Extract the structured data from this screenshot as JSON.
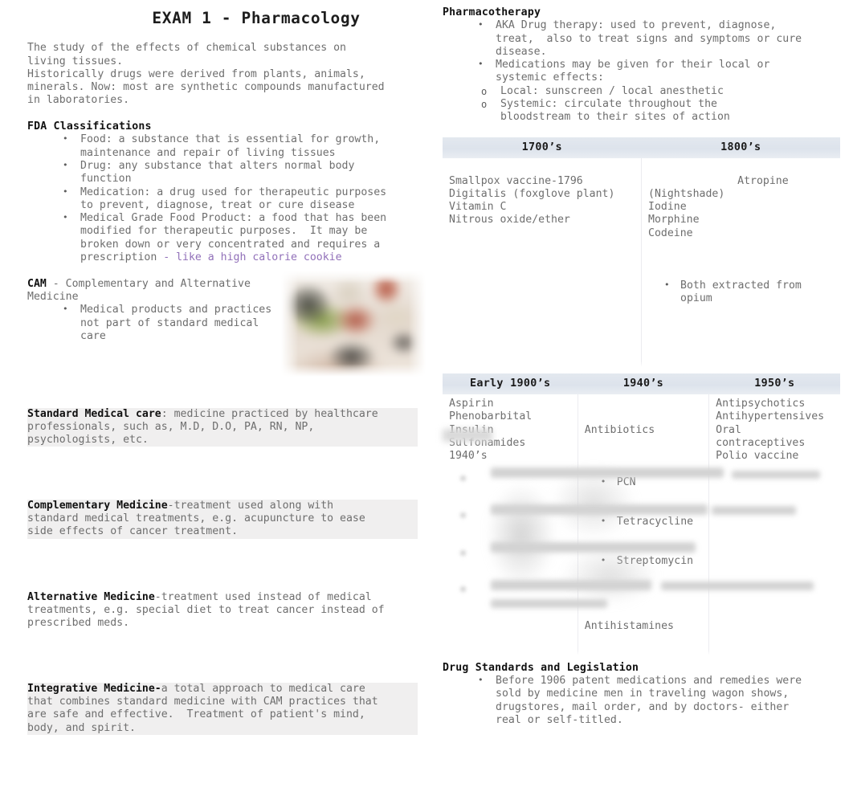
{
  "document": {
    "title": "EXAM 1 - Pharmacology"
  },
  "left": {
    "intro": "The study of the effects of chemical substances on\nliving tissues.\nHistorically drugs were derived from plants, animals,\nminerals. Now: most are synthetic compounds manufactured\nin laboratories.",
    "fda": {
      "heading": "FDA Classifications",
      "items": [
        "Food: a substance that is essential for growth,\nmaintenance and repair of living tissues",
        "Drug: any substance that alters normal body\nfunction",
        "Medication: a drug used for therapeutic purposes\nto prevent, diagnose, treat or cure disease"
      ],
      "last_item_main": "Medical Grade Food Product: a food that has been\nmodified for therapeutic purposes.  It may be\nbroken down or very concentrated and requires a\nprescription ",
      "last_item_accent": "- like a high calorie cookie"
    },
    "cam": {
      "term": "CAM",
      "definition": " - Complementary and Alternative\nMedicine",
      "items": [
        "Medical products and practices\nnot part of standard medical\ncare"
      ]
    },
    "definitions": [
      {
        "term": "Standard Medical care",
        "text": ": medicine practiced by healthcare\nprofessionals, such as, M.D, D.O, PA, RN, NP,\npsychologists, etc.",
        "highlight": true
      },
      {
        "term": "Complementary Medicine",
        "text": "-treatment used along with\nstandard medical treatments, e.g. acupuncture to ease\nside effects of cancer treatment.",
        "highlight": true
      },
      {
        "term": "Alternative Medicine",
        "text": "-treatment used instead of medical\ntreatments, e.g. special diet to treat cancer instead of\nprescribed meds.",
        "highlight": false
      },
      {
        "term": "Integrative Medicine-",
        "text": "a total approach to medical care\nthat combines standard medicine with CAM practices that\nare safe and effective.  Treatment of patient's mind,\nbody, and spirit.",
        "highlight": true
      }
    ]
  },
  "right": {
    "pharmacotherapy": {
      "heading": "Pharmacotherapy",
      "items": [
        "AKA Drug therapy: used to prevent, diagnose,\ntreat,  also to treat signs and symptoms or cure\ndisease.",
        "Medications may be given for their local or\nsystemic effects:"
      ],
      "subitems": [
        "Local: sunscreen / local anesthetic",
        "Systemic: circulate throughout the\nbloodstream to their sites of action"
      ]
    },
    "table_one": {
      "headers": [
        "1700’s",
        "1800’s"
      ],
      "cells": [
        "\nSmallpox vaccine-1796\nDigitalis (foxglove plant)\nVitamin C\nNitrous oxide/ether",
        "Atropine (Nightshade)\nIodine\nMorphine\nCodeine"
      ],
      "cell_two_bullets": [
        "Both extracted from\nopium"
      ]
    },
    "table_two": {
      "headers": [
        "Early 1900’s",
        "1940’s",
        "1950’s"
      ],
      "cell_one": "Aspirin\nPhenobarbital\nInsulin\nSulfonamides\n1940’s",
      "cell_two_top": "Antibiotics",
      "cell_two_bullets": [
        "PCN",
        "Tetracycline",
        "Streptomycin"
      ],
      "cell_two_bottom": "Antihistamines",
      "cell_three": "Antipsychotics\nAntihypertensives\nOral\ncontraceptives\nPolio vaccine"
    },
    "drug_standards": {
      "heading": "Drug Standards and Legislation",
      "items": [
        "Before 1906 patent medications and remedies were\nsold by medicine men in traveling wagon shows,\ndrugstores, mail order, and by doctors- either\nreal or self-titled."
      ]
    }
  },
  "colors": {
    "body_text": "#6e6e6e",
    "heading_text": "#111111",
    "accent_purple": "#9170b9",
    "table_header_bg": "#dde3ec",
    "highlight_bg": "#f0efef"
  }
}
